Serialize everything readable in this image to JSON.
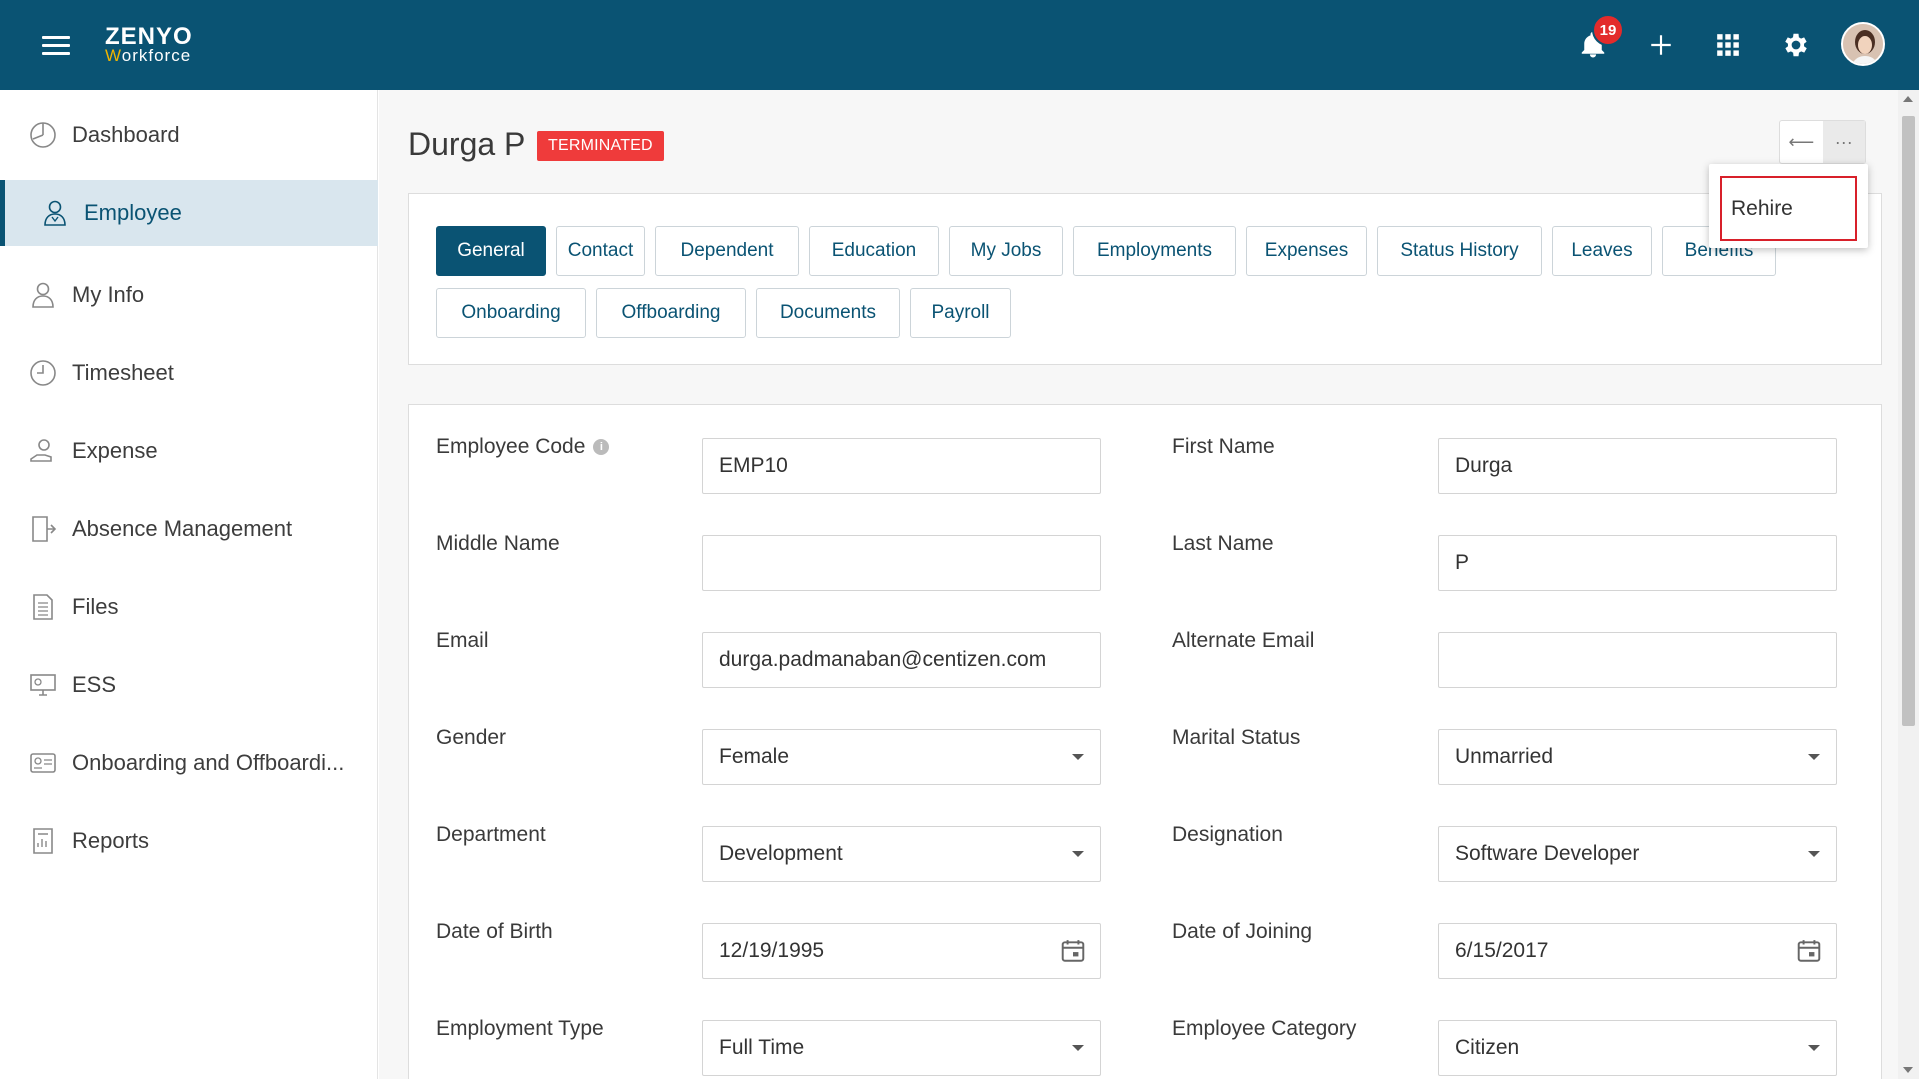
{
  "header": {
    "logo_top": "ZENY",
    "logo_o": "O",
    "logo_w": "W",
    "logo_rest": "orkforce",
    "notifications_count": "19"
  },
  "sidebar": {
    "items": [
      {
        "label": "Dashboard"
      },
      {
        "label": "Employee"
      },
      {
        "label": "My Info"
      },
      {
        "label": "Timesheet"
      },
      {
        "label": "Expense"
      },
      {
        "label": "Absence Management"
      },
      {
        "label": "Files"
      },
      {
        "label": "ESS"
      },
      {
        "label": "Onboarding and Offboardi..."
      },
      {
        "label": "Reports"
      }
    ]
  },
  "employee": {
    "name": "Durga P",
    "status": "TERMINATED"
  },
  "actions": {
    "back": "⟵",
    "more": "···"
  },
  "menu": {
    "rehire": "Rehire"
  },
  "tabs": [
    {
      "label": "General"
    },
    {
      "label": "Contact"
    },
    {
      "label": "Dependent"
    },
    {
      "label": "Education"
    },
    {
      "label": "My Jobs"
    },
    {
      "label": "Employments"
    },
    {
      "label": "Expenses"
    },
    {
      "label": "Status History"
    },
    {
      "label": "Leaves"
    },
    {
      "label": "Benefits"
    },
    {
      "label": "Onboarding"
    },
    {
      "label": "Offboarding"
    },
    {
      "label": "Documents"
    },
    {
      "label": "Payroll"
    }
  ],
  "form": {
    "employee_code": {
      "label": "Employee Code",
      "value": "EMP10"
    },
    "first_name": {
      "label": "First Name",
      "value": "Durga"
    },
    "middle_name": {
      "label": "Middle Name",
      "value": ""
    },
    "last_name": {
      "label": "Last Name",
      "value": "P"
    },
    "email": {
      "label": "Email",
      "value": "durga.padmanaban@centizen.com"
    },
    "alternate_email": {
      "label": "Alternate Email",
      "value": ""
    },
    "gender": {
      "label": "Gender",
      "value": "Female"
    },
    "marital_status": {
      "label": "Marital Status",
      "value": "Unmarried"
    },
    "department": {
      "label": "Department",
      "value": "Development"
    },
    "designation": {
      "label": "Designation",
      "value": "Software Developer"
    },
    "date_of_birth": {
      "label": "Date of Birth",
      "value": "12/19/1995"
    },
    "date_of_joining": {
      "label": "Date of Joining",
      "value": "6/15/2017"
    },
    "employment_type": {
      "label": "Employment Type",
      "value": "Full Time"
    },
    "employee_category": {
      "label": "Employee Category",
      "value": "Citizen"
    }
  },
  "colors": {
    "brand": "#0a5373",
    "terminated": "#ef3b3b",
    "notification": "#e32b2b",
    "highlight": "#d8202a"
  }
}
